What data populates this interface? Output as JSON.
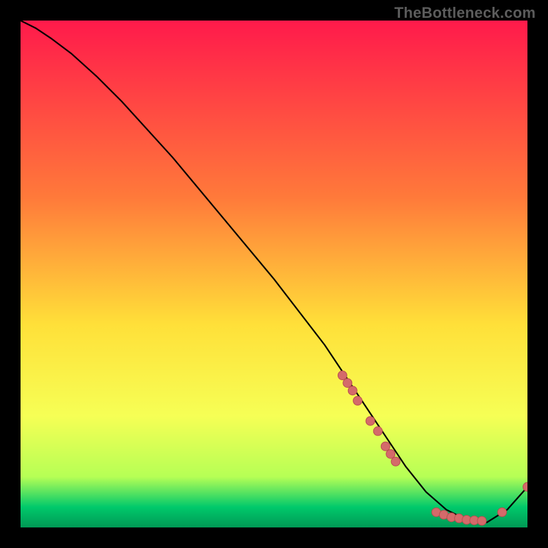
{
  "watermark": "TheBottleneck.com",
  "colors": {
    "background": "#000000",
    "curve": "#000000",
    "marker_fill": "#d46a6a",
    "marker_stroke": "#b94f4f",
    "gradient_top": "#ff1a4b",
    "gradient_mid1": "#ff9a3a",
    "gradient_mid2": "#ffe039",
    "gradient_mid3": "#d4ff55",
    "gradient_green": "#00c96b",
    "gradient_bottom": "#009955"
  },
  "chart_data": {
    "type": "line",
    "title": "",
    "xlabel": "",
    "ylabel": "",
    "xlim": [
      0,
      100
    ],
    "ylim": [
      0,
      100
    ],
    "curve": {
      "x": [
        0,
        3,
        6,
        10,
        15,
        20,
        30,
        40,
        50,
        60,
        68,
        72,
        76,
        80,
        84,
        88,
        92,
        96,
        100
      ],
      "y": [
        100,
        98.5,
        96.5,
        93.5,
        89,
        84,
        73,
        61,
        49,
        36,
        24,
        18,
        12,
        7,
        3.5,
        1.5,
        1,
        3.5,
        8
      ]
    },
    "markers": [
      {
        "x": 63.5,
        "y": 30
      },
      {
        "x": 64.5,
        "y": 28.5
      },
      {
        "x": 65.5,
        "y": 27
      },
      {
        "x": 66.5,
        "y": 25
      },
      {
        "x": 69,
        "y": 21
      },
      {
        "x": 70.5,
        "y": 19
      },
      {
        "x": 72,
        "y": 16
      },
      {
        "x": 73,
        "y": 14.5
      },
      {
        "x": 74,
        "y": 13
      },
      {
        "x": 82,
        "y": 3
      },
      {
        "x": 83.5,
        "y": 2.5
      },
      {
        "x": 85,
        "y": 2
      },
      {
        "x": 86.5,
        "y": 1.8
      },
      {
        "x": 88,
        "y": 1.5
      },
      {
        "x": 89.5,
        "y": 1.4
      },
      {
        "x": 91,
        "y": 1.3
      },
      {
        "x": 95,
        "y": 3
      },
      {
        "x": 100,
        "y": 8
      }
    ]
  }
}
